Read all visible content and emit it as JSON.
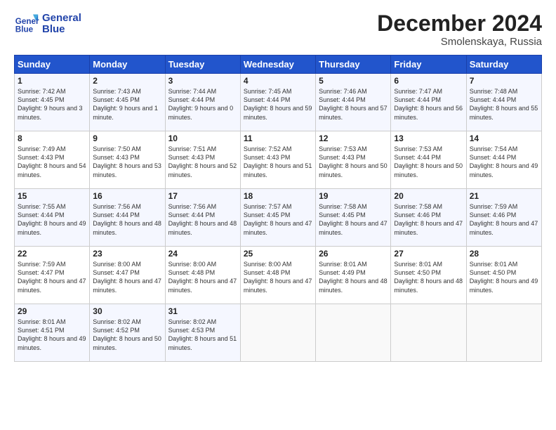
{
  "header": {
    "logo_line1": "General",
    "logo_line2": "Blue",
    "month": "December 2024",
    "location": "Smolenskaya, Russia"
  },
  "weekdays": [
    "Sunday",
    "Monday",
    "Tuesday",
    "Wednesday",
    "Thursday",
    "Friday",
    "Saturday"
  ],
  "weeks": [
    [
      {
        "day": "1",
        "sunrise": "7:42 AM",
        "sunset": "4:45 PM",
        "daylight": "9 hours and 3 minutes."
      },
      {
        "day": "2",
        "sunrise": "7:43 AM",
        "sunset": "4:45 PM",
        "daylight": "9 hours and 1 minute."
      },
      {
        "day": "3",
        "sunrise": "7:44 AM",
        "sunset": "4:44 PM",
        "daylight": "9 hours and 0 minutes."
      },
      {
        "day": "4",
        "sunrise": "7:45 AM",
        "sunset": "4:44 PM",
        "daylight": "8 hours and 59 minutes."
      },
      {
        "day": "5",
        "sunrise": "7:46 AM",
        "sunset": "4:44 PM",
        "daylight": "8 hours and 57 minutes."
      },
      {
        "day": "6",
        "sunrise": "7:47 AM",
        "sunset": "4:44 PM",
        "daylight": "8 hours and 56 minutes."
      },
      {
        "day": "7",
        "sunrise": "7:48 AM",
        "sunset": "4:44 PM",
        "daylight": "8 hours and 55 minutes."
      }
    ],
    [
      {
        "day": "8",
        "sunrise": "7:49 AM",
        "sunset": "4:43 PM",
        "daylight": "8 hours and 54 minutes."
      },
      {
        "day": "9",
        "sunrise": "7:50 AM",
        "sunset": "4:43 PM",
        "daylight": "8 hours and 53 minutes."
      },
      {
        "day": "10",
        "sunrise": "7:51 AM",
        "sunset": "4:43 PM",
        "daylight": "8 hours and 52 minutes."
      },
      {
        "day": "11",
        "sunrise": "7:52 AM",
        "sunset": "4:43 PM",
        "daylight": "8 hours and 51 minutes."
      },
      {
        "day": "12",
        "sunrise": "7:53 AM",
        "sunset": "4:43 PM",
        "daylight": "8 hours and 50 minutes."
      },
      {
        "day": "13",
        "sunrise": "7:53 AM",
        "sunset": "4:44 PM",
        "daylight": "8 hours and 50 minutes."
      },
      {
        "day": "14",
        "sunrise": "7:54 AM",
        "sunset": "4:44 PM",
        "daylight": "8 hours and 49 minutes."
      }
    ],
    [
      {
        "day": "15",
        "sunrise": "7:55 AM",
        "sunset": "4:44 PM",
        "daylight": "8 hours and 49 minutes."
      },
      {
        "day": "16",
        "sunrise": "7:56 AM",
        "sunset": "4:44 PM",
        "daylight": "8 hours and 48 minutes."
      },
      {
        "day": "17",
        "sunrise": "7:56 AM",
        "sunset": "4:44 PM",
        "daylight": "8 hours and 48 minutes."
      },
      {
        "day": "18",
        "sunrise": "7:57 AM",
        "sunset": "4:45 PM",
        "daylight": "8 hours and 47 minutes."
      },
      {
        "day": "19",
        "sunrise": "7:58 AM",
        "sunset": "4:45 PM",
        "daylight": "8 hours and 47 minutes."
      },
      {
        "day": "20",
        "sunrise": "7:58 AM",
        "sunset": "4:46 PM",
        "daylight": "8 hours and 47 minutes."
      },
      {
        "day": "21",
        "sunrise": "7:59 AM",
        "sunset": "4:46 PM",
        "daylight": "8 hours and 47 minutes."
      }
    ],
    [
      {
        "day": "22",
        "sunrise": "7:59 AM",
        "sunset": "4:47 PM",
        "daylight": "8 hours and 47 minutes."
      },
      {
        "day": "23",
        "sunrise": "8:00 AM",
        "sunset": "4:47 PM",
        "daylight": "8 hours and 47 minutes."
      },
      {
        "day": "24",
        "sunrise": "8:00 AM",
        "sunset": "4:48 PM",
        "daylight": "8 hours and 47 minutes."
      },
      {
        "day": "25",
        "sunrise": "8:00 AM",
        "sunset": "4:48 PM",
        "daylight": "8 hours and 47 minutes."
      },
      {
        "day": "26",
        "sunrise": "8:01 AM",
        "sunset": "4:49 PM",
        "daylight": "8 hours and 48 minutes."
      },
      {
        "day": "27",
        "sunrise": "8:01 AM",
        "sunset": "4:50 PM",
        "daylight": "8 hours and 48 minutes."
      },
      {
        "day": "28",
        "sunrise": "8:01 AM",
        "sunset": "4:50 PM",
        "daylight": "8 hours and 49 minutes."
      }
    ],
    [
      {
        "day": "29",
        "sunrise": "8:01 AM",
        "sunset": "4:51 PM",
        "daylight": "8 hours and 49 minutes."
      },
      {
        "day": "30",
        "sunrise": "8:02 AM",
        "sunset": "4:52 PM",
        "daylight": "8 hours and 50 minutes."
      },
      {
        "day": "31",
        "sunrise": "8:02 AM",
        "sunset": "4:53 PM",
        "daylight": "8 hours and 51 minutes."
      },
      null,
      null,
      null,
      null
    ]
  ]
}
